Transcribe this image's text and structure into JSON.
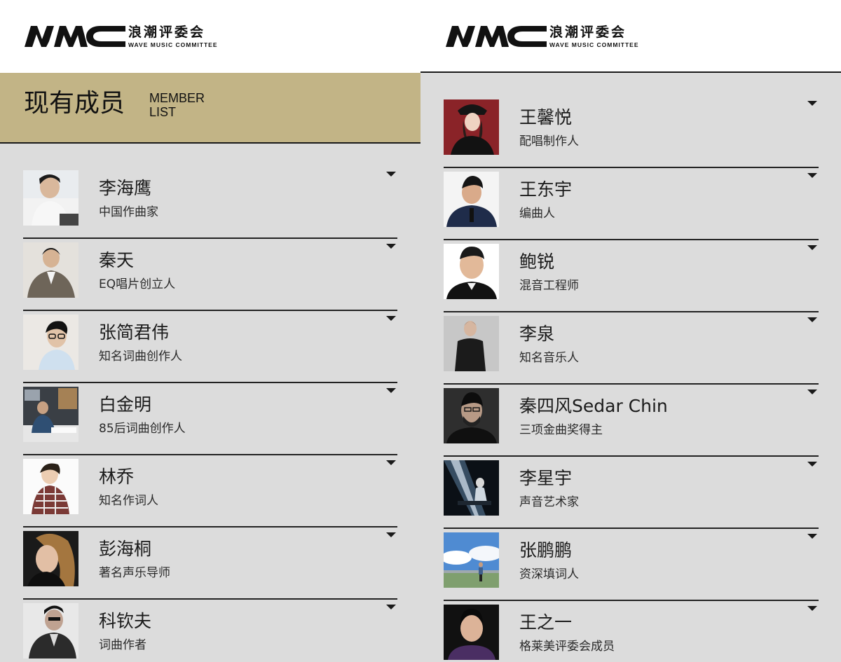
{
  "brand": {
    "name_cn": "浪潮评委会",
    "name_en": "WAVE MUSIC COMMITTEE",
    "logo_mark": "wmc-logo-mark"
  },
  "section": {
    "title_cn": "现有成员",
    "title_en_line1": "MEMBER",
    "title_en_line2": "LIST"
  },
  "colors": {
    "section_band": "#c2b486",
    "list_background": "#dcdcdc",
    "divider": "#222222",
    "header_background": "#ffffff"
  },
  "icons": {
    "expand": "caret-down-icon"
  },
  "left_members": [
    {
      "name": "李海鹰",
      "role": "中国作曲家"
    },
    {
      "name": "秦天",
      "role": "EQ唱片创立人"
    },
    {
      "name": "张简君伟",
      "role": "知名词曲创作人"
    },
    {
      "name": "白金明",
      "role": "85后词曲创作人"
    },
    {
      "name": "林乔",
      "role": "知名作词人"
    },
    {
      "name": "彭海桐",
      "role": "著名声乐导师"
    },
    {
      "name": "科钦夫",
      "role": "词曲作者"
    }
  ],
  "right_members": [
    {
      "name": "王馨悦",
      "role": "配唱制作人"
    },
    {
      "name": "王东宇",
      "role": "编曲人"
    },
    {
      "name": "鲍锐",
      "role": "混音工程师"
    },
    {
      "name": "李泉",
      "role": "知名音乐人"
    },
    {
      "name": "秦四风Sedar Chin",
      "role": "三项金曲奖得主"
    },
    {
      "name": "李星宇",
      "role": "声音艺术家"
    },
    {
      "name": "张鹏鹏",
      "role": "资深填词人"
    },
    {
      "name": "王之一",
      "role": "格莱美评委会成员"
    }
  ]
}
